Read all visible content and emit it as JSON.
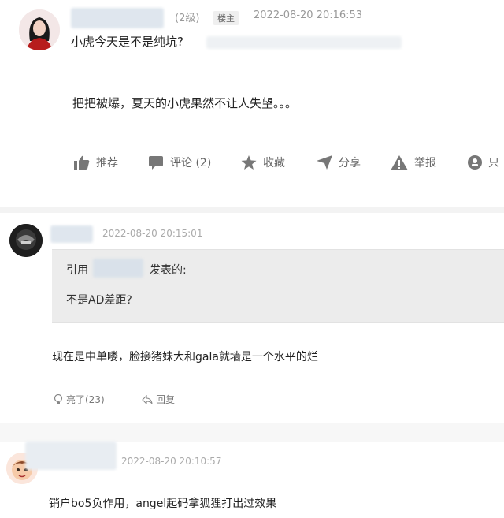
{
  "post": {
    "level": "(2级)",
    "tag": "楼主",
    "time": "2022-08-20 20:16:53",
    "title": "小虎今天是不是纯坑?",
    "body": "把把被爆，夏天的小虎果然不让人失望。。。",
    "actions": {
      "recommend": "推荐",
      "comment": "评论 (2)",
      "favorite": "收藏",
      "share": "分享",
      "report": "举报",
      "only": "只"
    }
  },
  "reply1": {
    "time": "2022-08-20 20:15:01",
    "quote_prefix": "引用",
    "quote_suffix": "发表的:",
    "quote_text": "不是AD差距?",
    "body": "现在是中单喽，脸接猪妹大和gala就墙是一个水平的烂",
    "like": "亮了(23)",
    "reply": "回复"
  },
  "reply2": {
    "time": "2022-08-20 20:10:57",
    "body": "销户bo5负作用，angel起码拿狐狸打出过效果"
  }
}
